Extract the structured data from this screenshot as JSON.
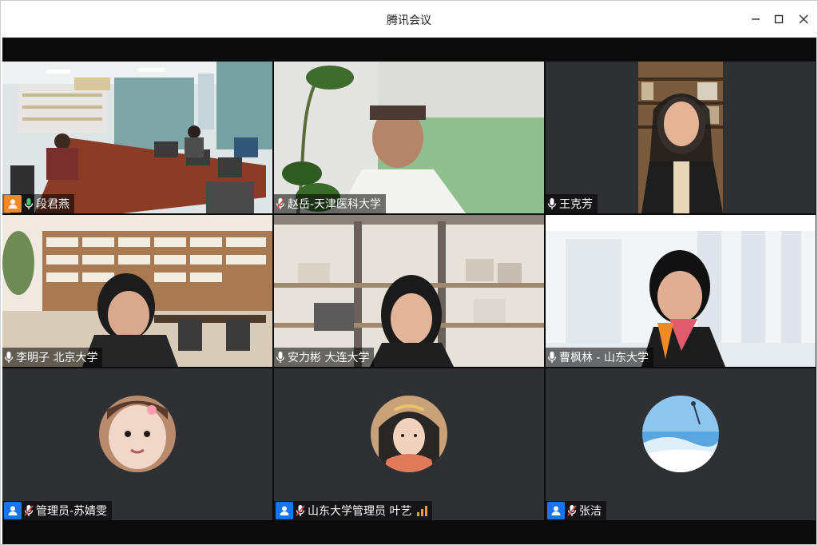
{
  "window": {
    "title": "腾讯会议",
    "minimize_icon": "minimize-icon",
    "maximize_icon": "maximize-icon",
    "close_icon": "close-icon"
  },
  "participants": [
    {
      "name": "段君燕",
      "mic": "on",
      "badge": "host-orange",
      "active_speaker": true,
      "video": "conference-room"
    },
    {
      "name": "赵岳-天津医科大学",
      "mic": "muted",
      "video": "man-green-wall"
    },
    {
      "name": "王克芳",
      "mic": "on",
      "video": "woman-bookshelf"
    },
    {
      "name": "李明子  北京大学",
      "mic": "on",
      "video": "woman-library"
    },
    {
      "name": "安力彬  大连大学",
      "mic": "on",
      "video": "woman-shelves"
    },
    {
      "name": "曹枫林 - 山东大学",
      "mic": "on",
      "video": "woman-white-room"
    },
    {
      "name": "管理员-苏婧雯",
      "mic": "muted",
      "badge": "user-blue",
      "video": "avatar-child"
    },
    {
      "name": "山东大学管理员 叶艺",
      "mic": "muted",
      "badge": "user-blue",
      "signal": "weak",
      "video": "avatar-woman"
    },
    {
      "name": "张洁",
      "mic": "muted",
      "badge": "user-blue",
      "video": "avatar-sky"
    }
  ],
  "colors": {
    "active_border": "#31c46b",
    "badge_blue": "#1a73e8",
    "badge_orange": "#f08a24",
    "muted_red": "#e04848",
    "signal_orange": "#f29b28"
  }
}
